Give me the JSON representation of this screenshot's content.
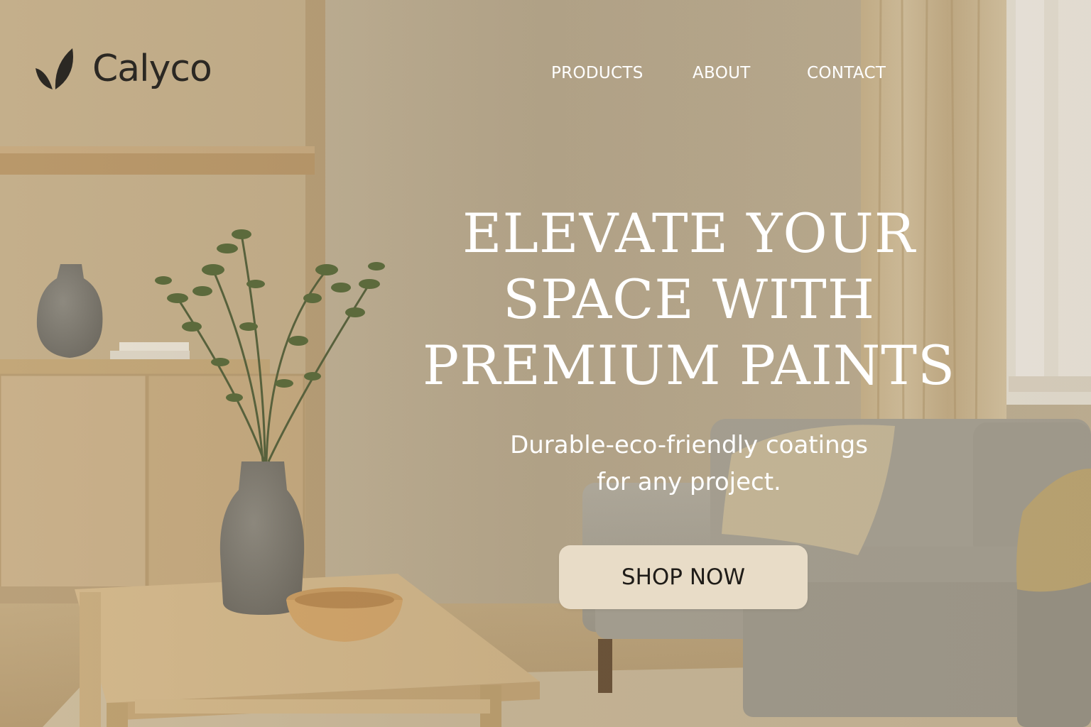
{
  "brand": {
    "name": "Calyco",
    "logo_icon": "leaf-icon"
  },
  "nav": {
    "items": [
      {
        "label": "PRODUCTS"
      },
      {
        "label": "ABOUT"
      },
      {
        "label": "CONTACT"
      }
    ]
  },
  "hero": {
    "title_lines": [
      "ELEVATE YOUR",
      "SPACE WITH",
      "PREMIUM PAINTS"
    ],
    "subtitle_lines": [
      "Durable-eco-friendly coatings",
      "for any project."
    ],
    "cta_label": "SHOP NOW"
  },
  "colors": {
    "text_light": "#ffffff",
    "logo_text": "#2b2823",
    "cta_bg": "#e8dcc7",
    "cta_text": "#1f1c18",
    "wall": "#bcae95"
  }
}
